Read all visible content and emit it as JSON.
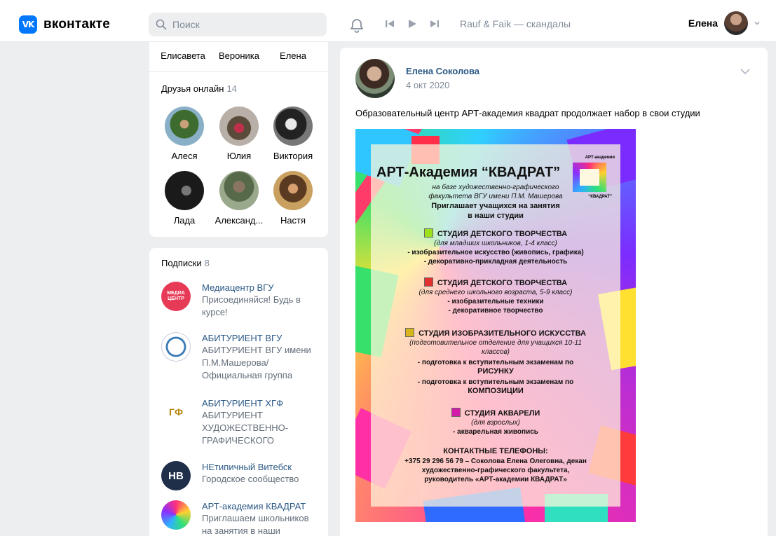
{
  "header": {
    "logo_mark": "VK",
    "logo_text": "вконтакте",
    "search_placeholder": "Поиск",
    "track": "Rauf & Faik — скандалы",
    "user_name": "Елена",
    "accent": "#0077ff"
  },
  "friends_top": {
    "names": [
      "Елисавета",
      "Вероника",
      "Елена"
    ]
  },
  "friends_online": {
    "title": "Друзья онлайн",
    "count": "14",
    "items": [
      {
        "name": "Алеся"
      },
      {
        "name": "Юлия"
      },
      {
        "name": "Виктория"
      },
      {
        "name": "Лада"
      },
      {
        "name": "Александ..."
      },
      {
        "name": "Настя"
      }
    ]
  },
  "subscriptions": {
    "title": "Подписки",
    "count": "8",
    "items": [
      {
        "name": "Медиацентр ВГУ",
        "desc": "Присоединяйся! Будь в курсе!",
        "logo_text": "МЕДИА ЦЕНТР"
      },
      {
        "name": "АБИТУРИЕНТ ВГУ",
        "desc": "АБИТУРИЕНТ ВГУ имени П.М.Машерова/ Официальная группа"
      },
      {
        "name": "АБИТУРИЕНТ ХГФ",
        "desc": "АБИТУРИЕНТ ХУДОЖЕСТВЕННО-ГРАФИЧЕСКОГО",
        "logo_text": "ГФ"
      },
      {
        "name": "НЕтипичный Витебск",
        "desc": "Городское сообщество",
        "logo_text": "НВ"
      },
      {
        "name": "АРТ-академия КВАДРАТ",
        "desc": "Приглашаем школьников на занятия в наши"
      }
    ]
  },
  "post": {
    "author": "Елена Соколова",
    "date": "4 окт 2020",
    "text": "Образовательный центр АРТ-академия квадрат продолжает набор в свои студии",
    "poster": {
      "title": "АРТ-Академия “КВАДРАТ”",
      "logo_top": "АРТ-академия",
      "logo_bottom": "“КВАДРАТ”",
      "sub1": "на базе художественно-графического",
      "sub2": "факультета ВГУ имени П.М. Машерова",
      "invite1": "Приглашает учащихся на занятия",
      "invite2": "в наши студии",
      "s1_title": "СТУДИЯ ДЕТСКОГО ТВОРЧЕСТВА",
      "s1_sub": "(для младших школьников, 1-4 класс)",
      "s1_l1": "- изобразительное искусство (живопись, графика)",
      "s1_l2": "- декоративно-прикладная деятельность",
      "s2_title": "СТУДИЯ ДЕТСКОГО ТВОРЧЕСТВА",
      "s2_sub": "(для среднего школьного возраста, 5-9 класс)",
      "s2_l1": "- изобразительные техники",
      "s2_l2": "- декоративное творчество",
      "s3_title": "СТУДИЯ ИЗОБРАЗИТЕЛЬНОГО ИСКУССТВА",
      "s3_sub1": "(подготовительное отделение для учащихся 10-11",
      "s3_sub2": "классов)",
      "s3_l1": "- подготовка к вступительным экзаменам по",
      "s3_l2": "РИСУНКУ",
      "s3_l3": "- подготовка к вступительным экзаменам по",
      "s3_l4": "КОМПОЗИЦИИ",
      "s4_title": "СТУДИЯ АКВАРЕЛИ",
      "s4_sub": "(для взрослых)",
      "s4_l1": "- акварельная живопись",
      "contacts_title": "КОНТАКТНЫЕ ТЕЛЕФОНЫ:",
      "contacts_l1": "+375 29 296 56 79 – Соколова Елена Олеговна, декан",
      "contacts_l2": "художественно-графического факультета,",
      "contacts_l3": "руководитель «АРТ-академии КВАДРАТ»",
      "colors": {
        "s1": "#9be21a",
        "s2": "#e0302f",
        "s3": "#d6b61a",
        "s4": "#d21ca8"
      }
    }
  }
}
